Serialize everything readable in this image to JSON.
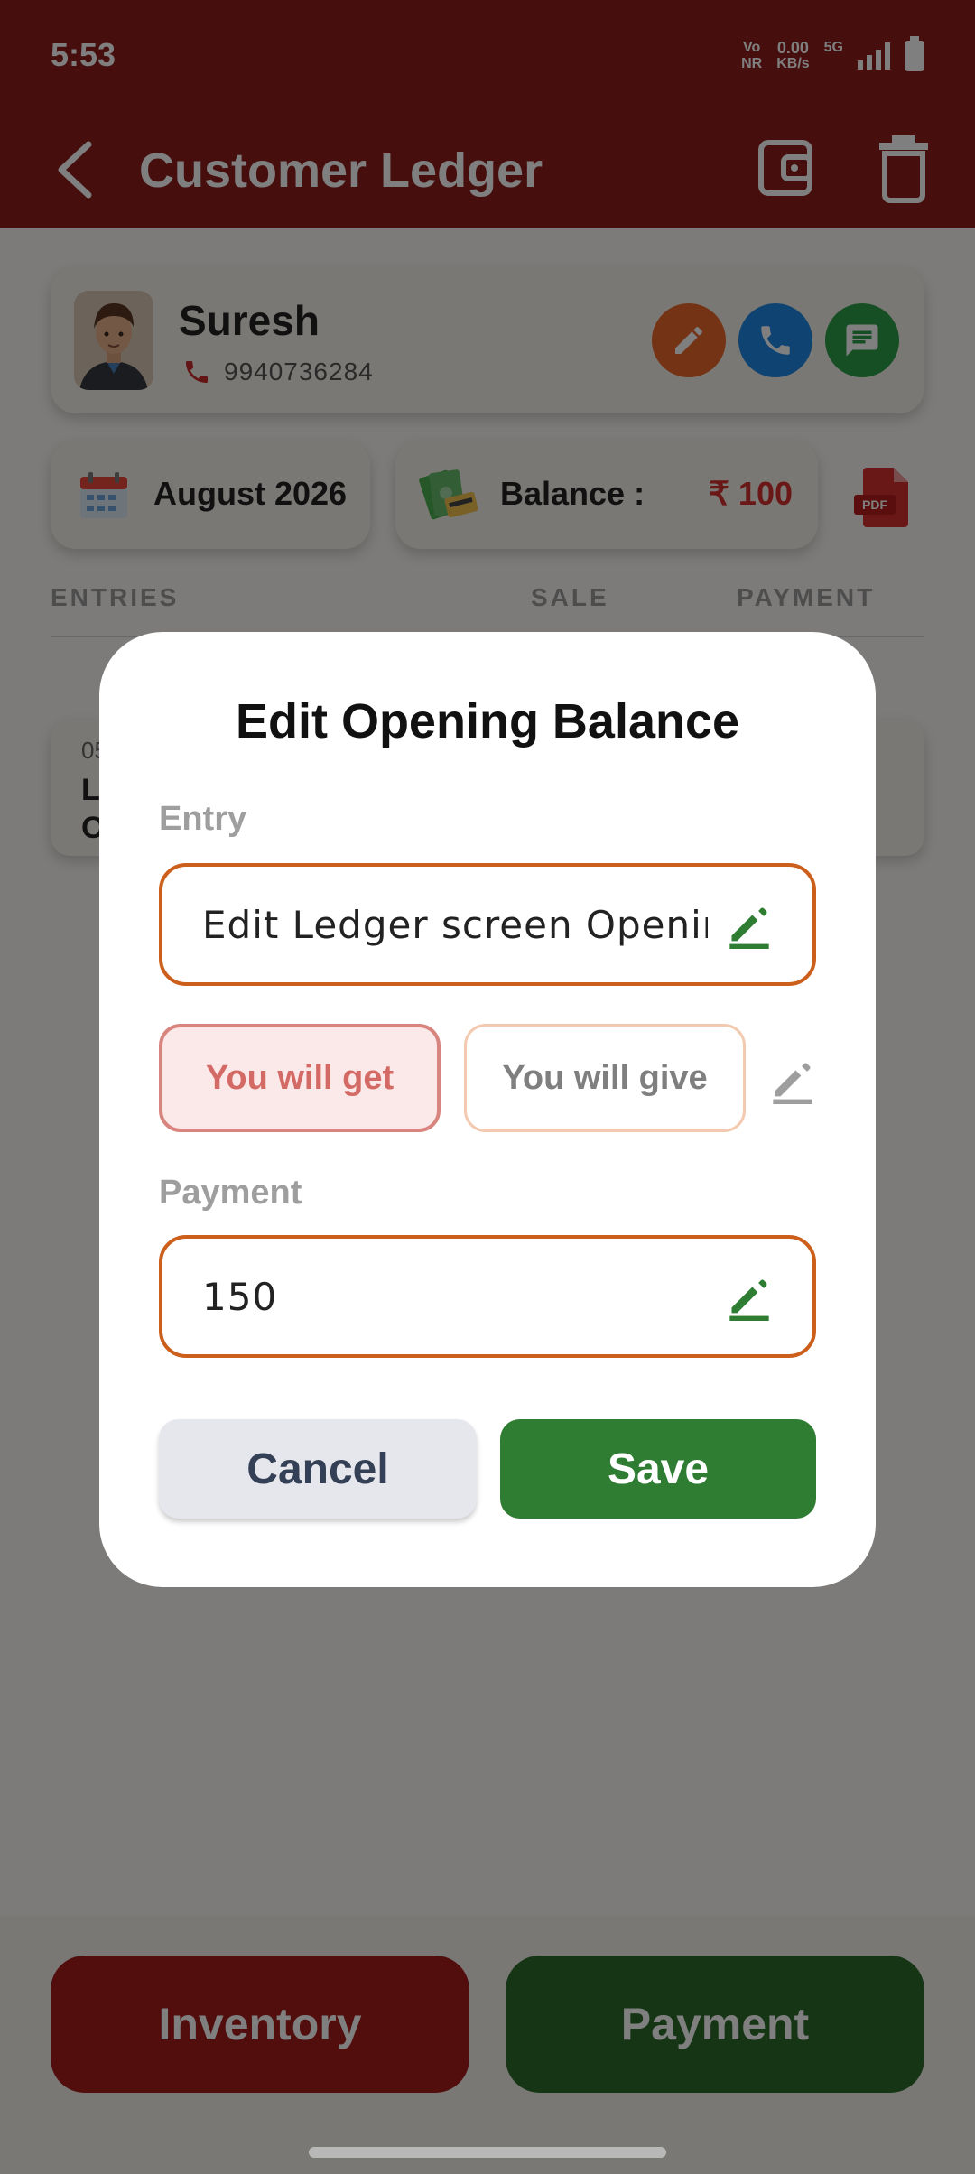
{
  "status_bar": {
    "time": "5:53",
    "network_top": "Vo",
    "network_bottom": "NR",
    "speed_value": "0.00",
    "speed_unit": "KB/s",
    "signal_type": "5G"
  },
  "app_bar": {
    "title": "Customer Ledger",
    "back_icon": "arrow-back-icon",
    "wallet_icon": "wallet-icon",
    "delete_icon": "trash-icon"
  },
  "customer": {
    "name": "Suresh",
    "phone": "9940736284"
  },
  "summary": {
    "month": "August 2026",
    "balance_label": "Balance :",
    "balance_value": "₹ 100",
    "pdf_label": "PDF"
  },
  "list": {
    "headers": [
      "ENTRIES",
      "SALE",
      "PAYMENT"
    ],
    "entry_date_fragment": "05",
    "entry_text_fragments": [
      "L",
      "O"
    ]
  },
  "bottom": {
    "inventory_label": "Inventory",
    "payment_label": "Payment"
  },
  "dialog": {
    "title": "Edit Opening Balance",
    "entry_label": "Entry",
    "entry_value": "Edit Ledger screen Opening",
    "toggle_get": "You will get",
    "toggle_give": "You will give",
    "payment_label": "Payment",
    "payment_value": "150",
    "cancel_label": "Cancel",
    "save_label": "Save"
  },
  "colors": {
    "app_bar": "#8e1c1c",
    "accent_orange": "#cc5f1c",
    "save_green": "#2e7d32",
    "balance_red": "#d32f2f"
  }
}
